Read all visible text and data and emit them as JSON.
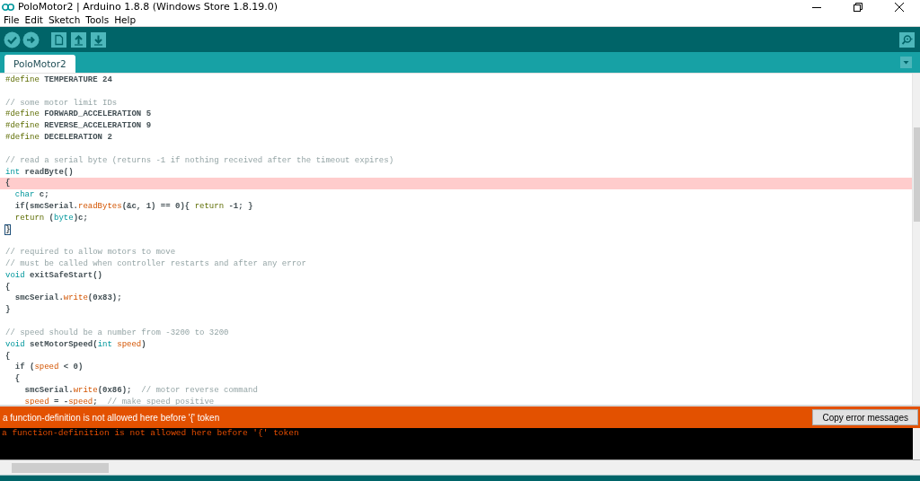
{
  "window": {
    "title": "PoloMotor2 | Arduino 1.8.8 (Windows Store 1.8.19.0)"
  },
  "menu": [
    "File",
    "Edit",
    "Sketch",
    "Tools",
    "Help"
  ],
  "tabs": [
    {
      "label": "PoloMotor2",
      "selected": true
    }
  ],
  "editor": {
    "lines": [
      {
        "kind": "code",
        "highlighted": false,
        "tokens": [
          {
            "kind": "preproc",
            "text": "#define"
          },
          {
            "kind": "plain",
            "text": " TEMPERATURE 24"
          }
        ]
      },
      {
        "kind": "blank",
        "highlighted": false
      },
      {
        "kind": "code",
        "highlighted": false,
        "tokens": [
          {
            "kind": "comment",
            "text": "// some motor limit IDs"
          }
        ]
      },
      {
        "kind": "code",
        "highlighted": false,
        "tokens": [
          {
            "kind": "preproc",
            "text": "#define"
          },
          {
            "kind": "plain",
            "text": " FORWARD_ACCELERATION 5"
          }
        ]
      },
      {
        "kind": "code",
        "highlighted": false,
        "tokens": [
          {
            "kind": "preproc",
            "text": "#define"
          },
          {
            "kind": "plain",
            "text": " REVERSE_ACCELERATION 9"
          }
        ]
      },
      {
        "kind": "code",
        "highlighted": false,
        "tokens": [
          {
            "kind": "preproc",
            "text": "#define"
          },
          {
            "kind": "plain",
            "text": " DECELERATION 2"
          }
        ]
      },
      {
        "kind": "blank",
        "highlighted": false
      },
      {
        "kind": "code",
        "highlighted": false,
        "tokens": [
          {
            "kind": "comment",
            "text": "// read a serial byte (returns -1 if nothing received after the timeout expires)"
          }
        ]
      },
      {
        "kind": "code",
        "highlighted": false,
        "tokens": [
          {
            "kind": "type",
            "text": "int"
          },
          {
            "kind": "plain",
            "text": " readByte()"
          }
        ]
      },
      {
        "kind": "code",
        "highlighted": true,
        "tokens": [
          {
            "kind": "plain",
            "text": "{"
          }
        ]
      },
      {
        "kind": "code",
        "highlighted": false,
        "tokens": [
          {
            "kind": "type",
            "text": "  char"
          },
          {
            "kind": "plain",
            "text": " c;"
          }
        ]
      },
      {
        "kind": "code",
        "highlighted": false,
        "tokens": [
          {
            "kind": "plain",
            "text": "  if(smcSerial."
          },
          {
            "kind": "func",
            "text": "readBytes"
          },
          {
            "kind": "plain",
            "text": "(&c, 1) == 0){ "
          },
          {
            "kind": "keyword",
            "text": "return"
          },
          {
            "kind": "plain",
            "text": " -1; }"
          }
        ]
      },
      {
        "kind": "code",
        "highlighted": false,
        "tokens": [
          {
            "kind": "keyword",
            "text": "  return"
          },
          {
            "kind": "plain",
            "text": " ("
          },
          {
            "kind": "type",
            "text": "byte"
          },
          {
            "kind": "plain",
            "text": ")c;"
          }
        ]
      },
      {
        "kind": "code",
        "highlighted": false,
        "tokens": [
          {
            "kind": "bracket",
            "text": "}"
          }
        ]
      },
      {
        "kind": "blank",
        "highlighted": false
      },
      {
        "kind": "code",
        "highlighted": false,
        "tokens": [
          {
            "kind": "comment",
            "text": "// required to allow motors to move"
          }
        ]
      },
      {
        "kind": "code",
        "highlighted": false,
        "tokens": [
          {
            "kind": "comment",
            "text": "// must be called when controller restarts and after any error"
          }
        ]
      },
      {
        "kind": "code",
        "highlighted": false,
        "tokens": [
          {
            "kind": "type",
            "text": "void"
          },
          {
            "kind": "plain",
            "text": " exitSafeStart()"
          }
        ]
      },
      {
        "kind": "code",
        "highlighted": false,
        "tokens": [
          {
            "kind": "plain",
            "text": "{"
          }
        ]
      },
      {
        "kind": "code",
        "highlighted": false,
        "tokens": [
          {
            "kind": "plain",
            "text": "  smcSerial."
          },
          {
            "kind": "func",
            "text": "write"
          },
          {
            "kind": "plain",
            "text": "(0x83);"
          }
        ]
      },
      {
        "kind": "code",
        "highlighted": false,
        "tokens": [
          {
            "kind": "plain",
            "text": "}"
          }
        ]
      },
      {
        "kind": "blank",
        "highlighted": false
      },
      {
        "kind": "code",
        "highlighted": false,
        "tokens": [
          {
            "kind": "comment",
            "text": "// speed should be a number from -3200 to 3200"
          }
        ]
      },
      {
        "kind": "code",
        "highlighted": false,
        "tokens": [
          {
            "kind": "type",
            "text": "void"
          },
          {
            "kind": "plain",
            "text": " setMotorSpeed("
          },
          {
            "kind": "type",
            "text": "int"
          },
          {
            "kind": "func",
            "text": " speed"
          },
          {
            "kind": "plain",
            "text": ")"
          }
        ]
      },
      {
        "kind": "code",
        "highlighted": false,
        "tokens": [
          {
            "kind": "plain",
            "text": "{"
          }
        ]
      },
      {
        "kind": "code",
        "highlighted": false,
        "tokens": [
          {
            "kind": "plain",
            "text": "  if ("
          },
          {
            "kind": "func",
            "text": "speed"
          },
          {
            "kind": "plain",
            "text": " < 0)"
          }
        ]
      },
      {
        "kind": "code",
        "highlighted": false,
        "tokens": [
          {
            "kind": "plain",
            "text": "  {"
          }
        ]
      },
      {
        "kind": "code",
        "highlighted": false,
        "tokens": [
          {
            "kind": "plain",
            "text": "    smcSerial."
          },
          {
            "kind": "func",
            "text": "write"
          },
          {
            "kind": "plain",
            "text": "(0x86);  "
          },
          {
            "kind": "comment",
            "text": "// motor reverse command"
          }
        ]
      },
      {
        "kind": "code",
        "highlighted": false,
        "tokens": [
          {
            "kind": "func",
            "text": "    speed"
          },
          {
            "kind": "plain",
            "text": " = -"
          },
          {
            "kind": "func",
            "text": "speed"
          },
          {
            "kind": "plain",
            "text": ";  "
          },
          {
            "kind": "comment",
            "text": "// make speed positive"
          }
        ]
      }
    ]
  },
  "error_bar": {
    "message": "a function-definition is not allowed here before '{' token",
    "button": "Copy error messages"
  },
  "console": {
    "lines": [
      "a function-definition is not allowed here before '{' token"
    ]
  }
}
